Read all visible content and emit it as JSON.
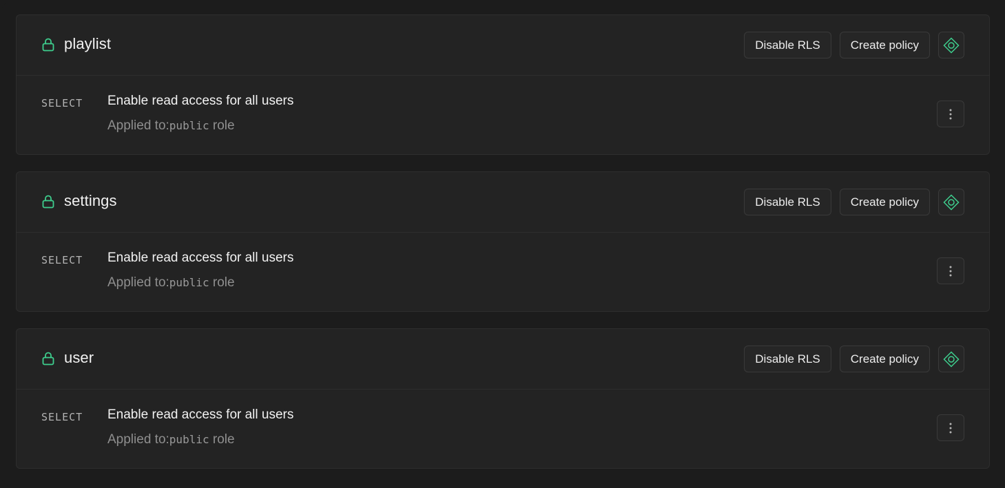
{
  "tables": [
    {
      "name": "playlist",
      "disable_rls_label": "Disable RLS",
      "create_policy_label": "Create policy",
      "policies": [
        {
          "command": "SELECT",
          "name": "Enable read access for all users",
          "applied_prefix": "Applied to:",
          "role": "public",
          "role_suffix": " role"
        }
      ]
    },
    {
      "name": "settings",
      "disable_rls_label": "Disable RLS",
      "create_policy_label": "Create policy",
      "policies": [
        {
          "command": "SELECT",
          "name": "Enable read access for all users",
          "applied_prefix": "Applied to:",
          "role": "public",
          "role_suffix": " role"
        }
      ]
    },
    {
      "name": "user",
      "disable_rls_label": "Disable RLS",
      "create_policy_label": "Create policy",
      "policies": [
        {
          "command": "SELECT",
          "name": "Enable read access for all users",
          "applied_prefix": "Applied to:",
          "role": "public",
          "role_suffix": " role"
        }
      ]
    }
  ],
  "icons": {
    "lock": "lock-icon",
    "table_editor": "diamond-target-icon",
    "more": "more-vertical-icon"
  },
  "colors": {
    "accent_green": "#3ecf8e",
    "background": "#1c1c1c",
    "card": "#232323",
    "border": "#2e2e2e"
  }
}
